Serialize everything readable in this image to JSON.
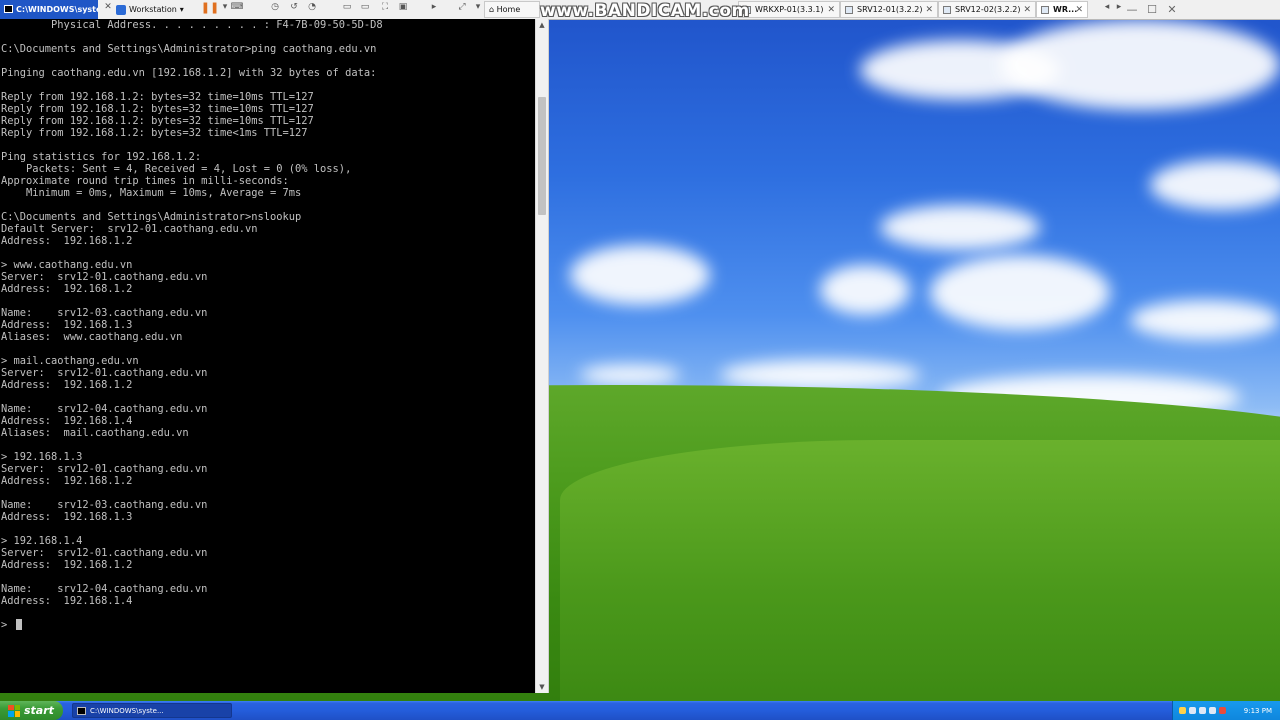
{
  "vmware": {
    "window_title": "C:\\WINDOWS\\syste...",
    "workstation_label": "Workstation",
    "tabs": [
      {
        "label": "Home"
      },
      {
        "label": "WRKXP-01(3.3.1)"
      },
      {
        "label": "SRV12-01(3.2.2)"
      },
      {
        "label": "SRV12-02(3.2.2)"
      },
      {
        "label": "WR..."
      }
    ],
    "watermark": "www.BANDICAM.com"
  },
  "console": {
    "lines": [
      "        Physical Address. . . . . . . . . : F4-7B-09-50-5D-D8",
      "",
      "C:\\Documents and Settings\\Administrator>ping caothang.edu.vn",
      "",
      "Pinging caothang.edu.vn [192.168.1.2] with 32 bytes of data:",
      "",
      "Reply from 192.168.1.2: bytes=32 time=10ms TTL=127",
      "Reply from 192.168.1.2: bytes=32 time=10ms TTL=127",
      "Reply from 192.168.1.2: bytes=32 time=10ms TTL=127",
      "Reply from 192.168.1.2: bytes=32 time<1ms TTL=127",
      "",
      "Ping statistics for 192.168.1.2:",
      "    Packets: Sent = 4, Received = 4, Lost = 0 (0% loss),",
      "Approximate round trip times in milli-seconds:",
      "    Minimum = 0ms, Maximum = 10ms, Average = 7ms",
      "",
      "C:\\Documents and Settings\\Administrator>nslookup",
      "Default Server:  srv12-01.caothang.edu.vn",
      "Address:  192.168.1.2",
      "",
      "> www.caothang.edu.vn",
      "Server:  srv12-01.caothang.edu.vn",
      "Address:  192.168.1.2",
      "",
      "Name:    srv12-03.caothang.edu.vn",
      "Address:  192.168.1.3",
      "Aliases:  www.caothang.edu.vn",
      "",
      "> mail.caothang.edu.vn",
      "Server:  srv12-01.caothang.edu.vn",
      "Address:  192.168.1.2",
      "",
      "Name:    srv12-04.caothang.edu.vn",
      "Address:  192.168.1.4",
      "Aliases:  mail.caothang.edu.vn",
      "",
      "> 192.168.1.3",
      "Server:  srv12-01.caothang.edu.vn",
      "Address:  192.168.1.2",
      "",
      "Name:    srv12-03.caothang.edu.vn",
      "Address:  192.168.1.3",
      "",
      "> 192.168.1.4",
      "Server:  srv12-01.caothang.edu.vn",
      "Address:  192.168.1.2",
      "",
      "Name:    srv12-04.caothang.edu.vn",
      "Address:  192.168.1.4",
      ""
    ],
    "prompt": ">"
  },
  "taskbar": {
    "start_label": "start",
    "task_item_label": "C:\\WINDOWS\\syste...",
    "clock": "9:13 PM"
  },
  "colors": {
    "console_text": "#c0c0c0",
    "console_bg": "#000000",
    "taskbar_blue": "#245ddb",
    "start_green": "#3a9b36",
    "tray_blue": "#1899ee"
  }
}
